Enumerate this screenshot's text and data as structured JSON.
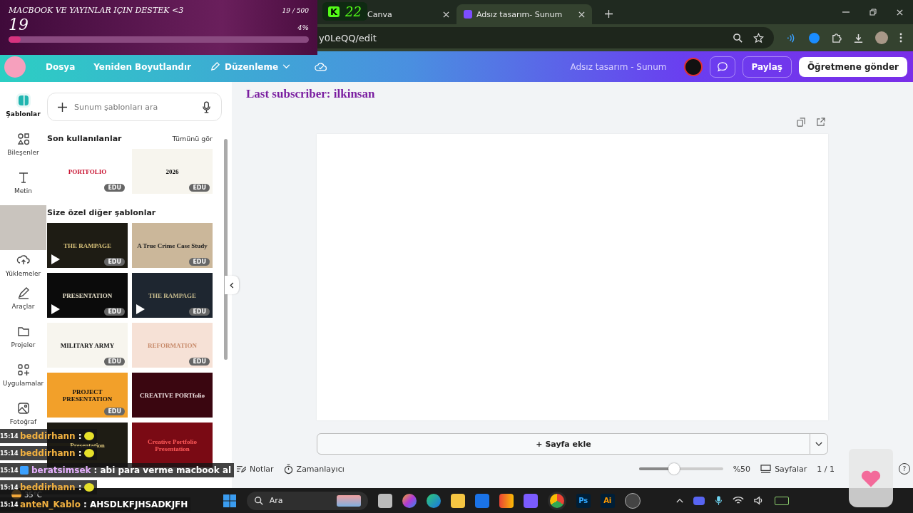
{
  "donation_overlay": {
    "title": "MACBOOK VE YAYINLAR IÇIN DESTEK <3",
    "goal": "19 / 500",
    "amount": "19",
    "percent": "4%",
    "level": 0.04
  },
  "counter_overlay": {
    "letter": "K",
    "count": "22"
  },
  "browser": {
    "tabs": [
      {
        "title": "Canva",
        "selected": false
      },
      {
        "title": "Adsız tasarım- Sunum",
        "selected": true
      }
    ],
    "url": "y0LeQQ/edit"
  },
  "header": {
    "menu": [
      {
        "label": "Dosya",
        "kind": "plain"
      },
      {
        "label": "Yeniden Boyutlandır",
        "kind": "plain"
      },
      {
        "label": "Düzenleme",
        "kind": "edit"
      }
    ],
    "doc_title": "Adsız tasarım - Sunum",
    "share": "Paylaş",
    "send": "Öğretmene gönder"
  },
  "subscriber_overlay": "Last subscriber: ilkinsan",
  "rail": [
    {
      "label": "Şablonlar",
      "selected": true
    },
    {
      "label": "Bileşenler",
      "selected": false
    },
    {
      "label": "Metin",
      "selected": false
    },
    {
      "label": "Yüklemeler",
      "selected": false
    },
    {
      "label": "Araçlar",
      "selected": false
    },
    {
      "label": "Projeler",
      "selected": false
    },
    {
      "label": "Uygulamalar",
      "selected": false
    },
    {
      "label": "Fotoğraf",
      "selected": false
    }
  ],
  "panel": {
    "search_placeholder": "Sunum şablonları ara",
    "recent_heading": "Son kullanılanlar",
    "see_all": "Tümünü gör",
    "recent": [
      {
        "title": "PORTFOLIO",
        "kind": "light-red",
        "video": false,
        "badge": "EDU"
      },
      {
        "title": "2026",
        "kind": "light",
        "video": false,
        "badge": "EDU"
      }
    ],
    "more_heading": "Size özel diğer şablonlar",
    "more": [
      {
        "title": "THE RAMPAGE",
        "kind": "dark-gold",
        "video": true,
        "badge": "EDU"
      },
      {
        "title": "A True Crime Case Study",
        "kind": "beige",
        "video": false,
        "badge": "EDU"
      },
      {
        "title": "PRESENTATION",
        "kind": "dark",
        "video": true,
        "badge": "EDU"
      },
      {
        "title": "THE RAMPAGE",
        "kind": "dark-blue",
        "video": true,
        "badge": "EDU"
      },
      {
        "title": "MILITARY ARMY",
        "kind": "light",
        "video": false,
        "badge": "EDU"
      },
      {
        "title": "REFORMATION",
        "kind": "peach",
        "video": false,
        "badge": "EDU"
      },
      {
        "title": "PROJECT PRESENTATION",
        "kind": "orange",
        "video": false,
        "badge": "EDU"
      },
      {
        "title": "CREATIVE PORTfolio",
        "kind": "dark-red",
        "video": false
      },
      {
        "title": "Presentation",
        "kind": "dark-gold",
        "video": false
      },
      {
        "title": "Creative Portfolio Presentation",
        "kind": "red",
        "video": false
      }
    ]
  },
  "canvas": {
    "add_page": "+ Sayfa ekle"
  },
  "bottom_bar": {
    "notes": "Notlar",
    "timer": "Zamanlayıcı",
    "level": 0.42,
    "zoom": "%50",
    "pages": "Sayfalar",
    "page_count": "1 / 1",
    "help": "?"
  },
  "chat": [
    {
      "time": "15:14",
      "user": "beddirhann",
      "text": ":",
      "emote": true,
      "badge": false
    },
    {
      "time": "15:14",
      "user": "beddirhann",
      "text": ":",
      "emote": true,
      "badge": false
    },
    {
      "time": "15:14",
      "user": "beratsimsek",
      "text": ": abi para verme macbook al",
      "emote": false,
      "badge": true
    },
    {
      "time": "15:14",
      "user": "beddirhann",
      "text": ":",
      "emote": true,
      "badge": false
    },
    {
      "time": "15:14",
      "user": "anteN_Kablo",
      "text": ": AHSDLKFJHSADKJFH",
      "emote": false,
      "badge": false
    }
  ],
  "taskbar": {
    "search": "Ara",
    "weather": "35°C",
    "lettered_apps": [
      {
        "label": "Ps",
        "color": "#31a8ff"
      },
      {
        "label": "Ai",
        "color": "#ff9a00"
      }
    ]
  }
}
